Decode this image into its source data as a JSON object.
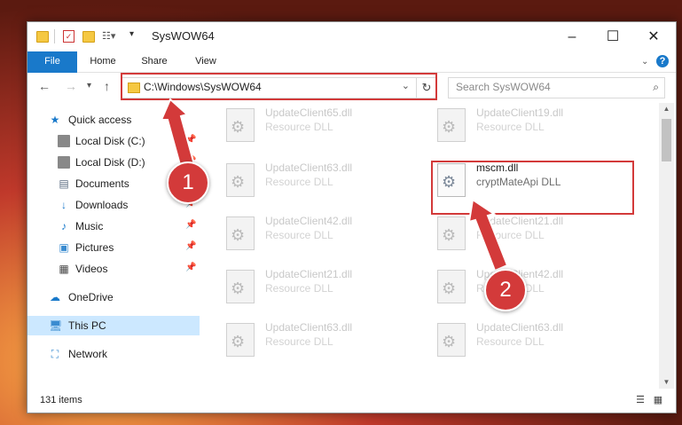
{
  "window": {
    "title": "SysWOW64"
  },
  "ribbon": {
    "tabs": [
      {
        "label": "File"
      },
      {
        "label": "Home"
      },
      {
        "label": "Share"
      },
      {
        "label": "View"
      }
    ],
    "help": "?"
  },
  "address": {
    "path": "C:\\Windows\\SysWOW64"
  },
  "search": {
    "placeholder": "Search SysWOW64"
  },
  "sidebar": {
    "items": [
      {
        "label": "Quick access",
        "icon": "star-icon"
      },
      {
        "label": "Local Disk (C:)",
        "icon": "drive-icon",
        "pinned": true
      },
      {
        "label": "Local Disk (D:)",
        "icon": "drive-icon",
        "pinned": true
      },
      {
        "label": "Documents",
        "icon": "documents-icon",
        "pinned": true
      },
      {
        "label": "Downloads",
        "icon": "downloads-icon",
        "pinned": true
      },
      {
        "label": "Music",
        "icon": "music-icon",
        "pinned": true
      },
      {
        "label": "Pictures",
        "icon": "pictures-icon",
        "pinned": true
      },
      {
        "label": "Videos",
        "icon": "videos-icon",
        "pinned": true
      },
      {
        "label": "OneDrive",
        "icon": "onedrive-icon"
      },
      {
        "label": "This PC",
        "icon": "pc-icon",
        "selected": true
      },
      {
        "label": "Network",
        "icon": "network-icon"
      }
    ]
  },
  "files": [
    {
      "name": "UpdateClient65.dll",
      "desc": "Resource DLL"
    },
    {
      "name": "UpdateClient19.dll",
      "desc": "Resource DLL"
    },
    {
      "name": "UpdateClient63.dll",
      "desc": "Resource DLL"
    },
    {
      "name": "mscm.dll",
      "desc": "cryptMateApi DLL",
      "highlighted": true
    },
    {
      "name": "UpdateClient42.dll",
      "desc": "Resource DLL"
    },
    {
      "name": "UpdateClient21.dll",
      "desc": "Resource DLL"
    },
    {
      "name": "UpdateClient21.dll",
      "desc": "Resource DLL"
    },
    {
      "name": "UpdateClient42.dll",
      "desc": "Resource DLL"
    },
    {
      "name": "UpdateClient63.dll",
      "desc": "Resource DLL"
    },
    {
      "name": "UpdateClient63.dll",
      "desc": "Resource DLL"
    }
  ],
  "status": {
    "items_count": "131 items"
  },
  "callouts": {
    "one": "1",
    "two": "2"
  },
  "colors": {
    "accent": "#1979ca",
    "highlight_box": "#d33a3a",
    "selected_bg": "#cce8ff"
  }
}
